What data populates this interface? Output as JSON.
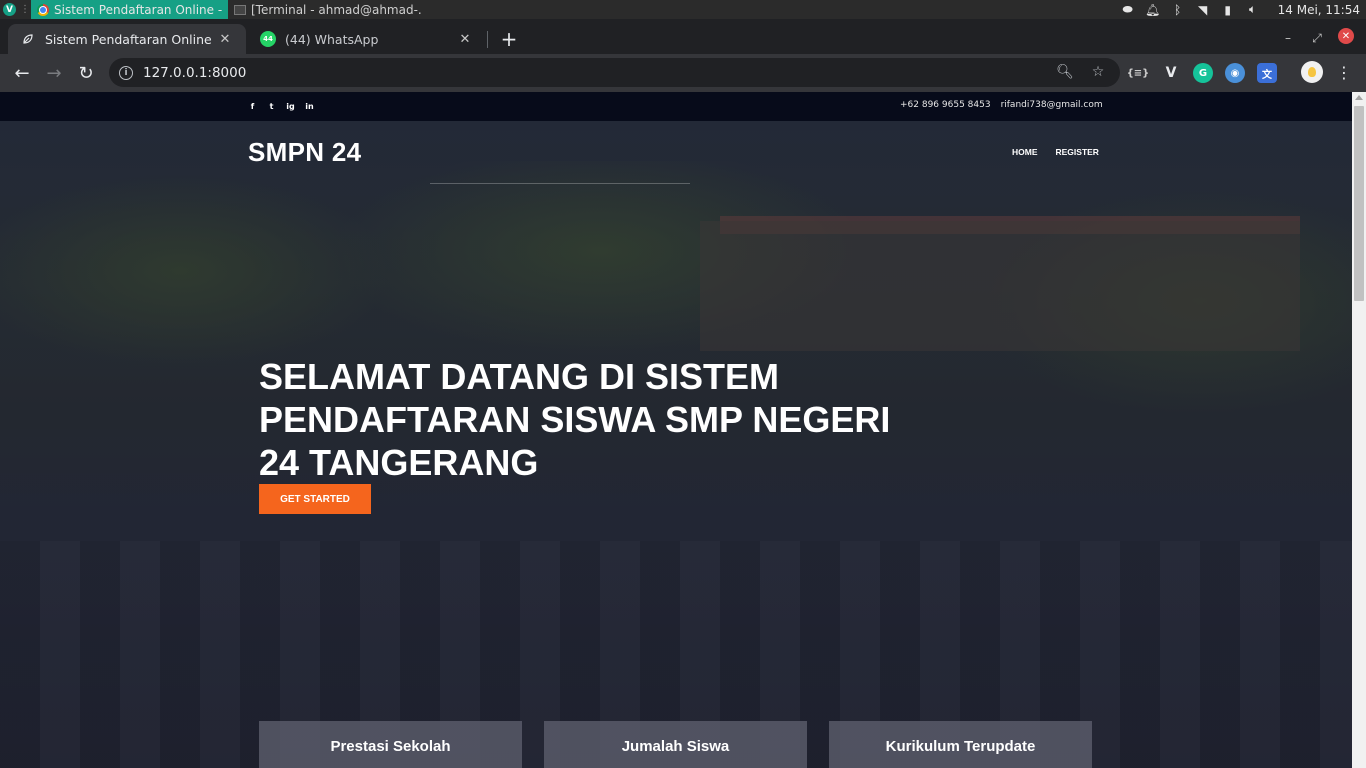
{
  "os": {
    "active_task": "Sistem Pendaftaran Online - ...",
    "inactive_task": "[Terminal - ahmad@ahmad-...",
    "clock": "14 Mei, 11:54",
    "app_badge": "V"
  },
  "browser": {
    "tabs": [
      {
        "title": "Sistem Pendaftaran Online",
        "icon": "leaf-icon"
      },
      {
        "title": "(44) WhatsApp",
        "icon": "whatsapp-icon",
        "badge": "44"
      }
    ],
    "url": "127.0.0.1:8000",
    "extensions": [
      "json-icon",
      "vimeo-v-icon",
      "grammarly-icon",
      "globe-icon",
      "translate-icon"
    ]
  },
  "site": {
    "topbar": {
      "social": [
        "f",
        "t",
        "ig",
        "in"
      ],
      "phone": "+62 896 9655 8453",
      "email": "rifandi738@gmail.com"
    },
    "brand": "SMPN 24",
    "nav": [
      "HOME",
      "REGISTER"
    ],
    "hero_title": "SELAMAT DATANG DI SISTEM PENDAFTARAN SISWA SMP NEGERI 24 TANGERANG",
    "cta_label": "GET STARTED",
    "cards": [
      "Prestasi Sekolah",
      "Jumalah Siswa",
      "Kurikulum Terupdate"
    ]
  },
  "colors": {
    "accent": "#f5651d",
    "topbar": "#070b1a",
    "os_active_task": "#16a085"
  }
}
